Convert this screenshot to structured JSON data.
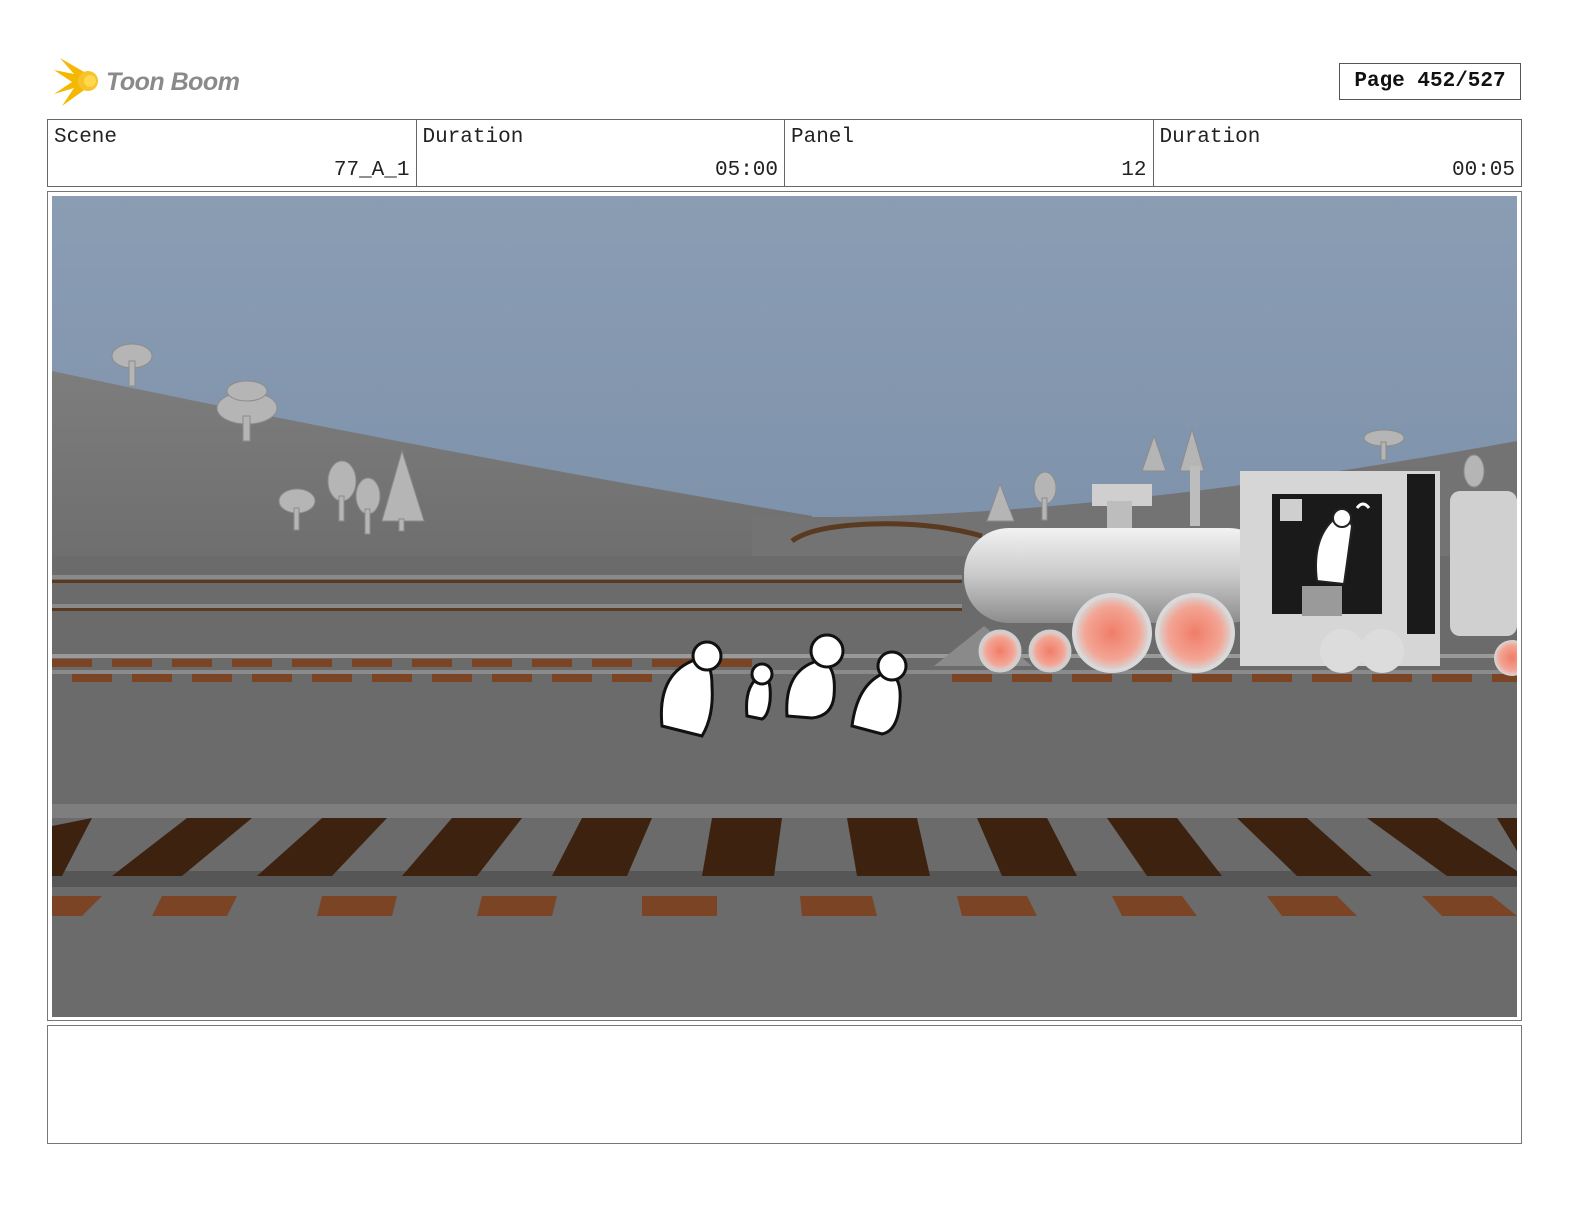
{
  "header": {
    "logo_text": "Toon Boom",
    "page_label": "Page 452/527"
  },
  "info": {
    "scene_label": "Scene",
    "scene_value": "77_A_1",
    "duration_label": "Duration",
    "duration_value": "05:00",
    "panel_label": "Panel",
    "panel_value": "12",
    "panel_duration_label": "Duration",
    "panel_duration_value": "00:05"
  },
  "notes": {
    "text": ""
  },
  "colors": {
    "sky_top": "#8a9db3",
    "sky_bottom": "#6d82a0",
    "ground": "#6b6b6b",
    "tie_brown": "#4a2a15",
    "wheel_red": "#e88870",
    "logo_yellow": "#f5b800"
  }
}
